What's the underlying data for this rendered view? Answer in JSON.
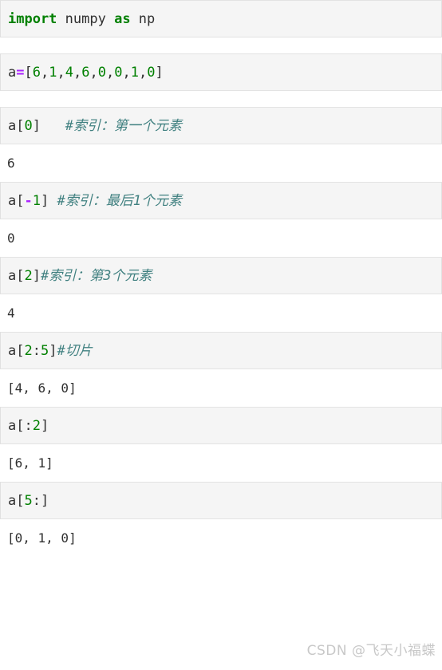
{
  "notebook": {
    "cells": [
      {
        "id": "cell-import",
        "tokens": [
          {
            "t": "import",
            "c": "kw"
          },
          {
            "t": " numpy ",
            "c": "name"
          },
          {
            "t": "as",
            "c": "kw"
          },
          {
            "t": " np",
            "c": "name"
          }
        ],
        "code_text": "import numpy as np",
        "output": null
      },
      {
        "id": "cell-assign",
        "tokens": [
          {
            "t": "a",
            "c": "name"
          },
          {
            "t": "=",
            "c": "op"
          },
          {
            "t": "[",
            "c": "punct"
          },
          {
            "t": "6",
            "c": "num"
          },
          {
            "t": ",",
            "c": "punct"
          },
          {
            "t": "1",
            "c": "num"
          },
          {
            "t": ",",
            "c": "punct"
          },
          {
            "t": "4",
            "c": "num"
          },
          {
            "t": ",",
            "c": "punct"
          },
          {
            "t": "6",
            "c": "num"
          },
          {
            "t": ",",
            "c": "punct"
          },
          {
            "t": "0",
            "c": "num"
          },
          {
            "t": ",",
            "c": "punct"
          },
          {
            "t": "0",
            "c": "num"
          },
          {
            "t": ",",
            "c": "punct"
          },
          {
            "t": "1",
            "c": "num"
          },
          {
            "t": ",",
            "c": "punct"
          },
          {
            "t": "0",
            "c": "num"
          },
          {
            "t": "]",
            "c": "punct"
          }
        ],
        "code_text": "a=[6,1,4,6,0,0,1,0]",
        "output": null
      },
      {
        "id": "cell-index-first",
        "tokens": [
          {
            "t": "a",
            "c": "name"
          },
          {
            "t": "[",
            "c": "punct"
          },
          {
            "t": "0",
            "c": "num"
          },
          {
            "t": "]",
            "c": "punct"
          },
          {
            "t": "   ",
            "c": "punct"
          },
          {
            "t": "#索引：第一个元素",
            "c": "comment"
          }
        ],
        "code_text": "a[0]   #索引：第一个元素",
        "output": "6"
      },
      {
        "id": "cell-index-last",
        "tokens": [
          {
            "t": "a",
            "c": "name"
          },
          {
            "t": "[",
            "c": "punct"
          },
          {
            "t": "-",
            "c": "op"
          },
          {
            "t": "1",
            "c": "num"
          },
          {
            "t": "]",
            "c": "punct"
          },
          {
            "t": " ",
            "c": "punct"
          },
          {
            "t": "#索引：最后1个元素",
            "c": "comment"
          }
        ],
        "code_text": "a[-1] #索引：最后1个元素",
        "output": "0"
      },
      {
        "id": "cell-index-third",
        "tokens": [
          {
            "t": "a",
            "c": "name"
          },
          {
            "t": "[",
            "c": "punct"
          },
          {
            "t": "2",
            "c": "num"
          },
          {
            "t": "]",
            "c": "punct"
          },
          {
            "t": "#索引：第3个元素",
            "c": "comment"
          }
        ],
        "code_text": "a[2]#索引：第3个元素",
        "output": "4"
      },
      {
        "id": "cell-slice-2-5",
        "tokens": [
          {
            "t": "a",
            "c": "name"
          },
          {
            "t": "[",
            "c": "punct"
          },
          {
            "t": "2",
            "c": "num"
          },
          {
            "t": ":",
            "c": "punct"
          },
          {
            "t": "5",
            "c": "num"
          },
          {
            "t": "]",
            "c": "punct"
          },
          {
            "t": "#切片",
            "c": "comment"
          }
        ],
        "code_text": "a[2:5]#切片",
        "output": "[4, 6, 0]"
      },
      {
        "id": "cell-slice-head",
        "tokens": [
          {
            "t": "a",
            "c": "name"
          },
          {
            "t": "[",
            "c": "punct"
          },
          {
            "t": ":",
            "c": "punct"
          },
          {
            "t": "2",
            "c": "num"
          },
          {
            "t": "]",
            "c": "punct"
          }
        ],
        "code_text": "a[:2]",
        "output": "[6, 1]"
      },
      {
        "id": "cell-slice-tail",
        "tokens": [
          {
            "t": "a",
            "c": "name"
          },
          {
            "t": "[",
            "c": "punct"
          },
          {
            "t": "5",
            "c": "num"
          },
          {
            "t": ":",
            "c": "punct"
          },
          {
            "t": "]",
            "c": "punct"
          }
        ],
        "code_text": "a[5:]",
        "output": "[0, 1, 0]"
      }
    ]
  },
  "watermark": {
    "text": "CSDN @飞天小福蝶"
  },
  "colors": {
    "keyword": "#008000",
    "number": "#008000",
    "operator": "#aa22ff",
    "comment": "#408080",
    "text": "#303030",
    "cell_background": "#f5f5f5",
    "cell_border": "#e3e3e3",
    "page_background": "#ffffff",
    "watermark": "#c8c8c8"
  }
}
